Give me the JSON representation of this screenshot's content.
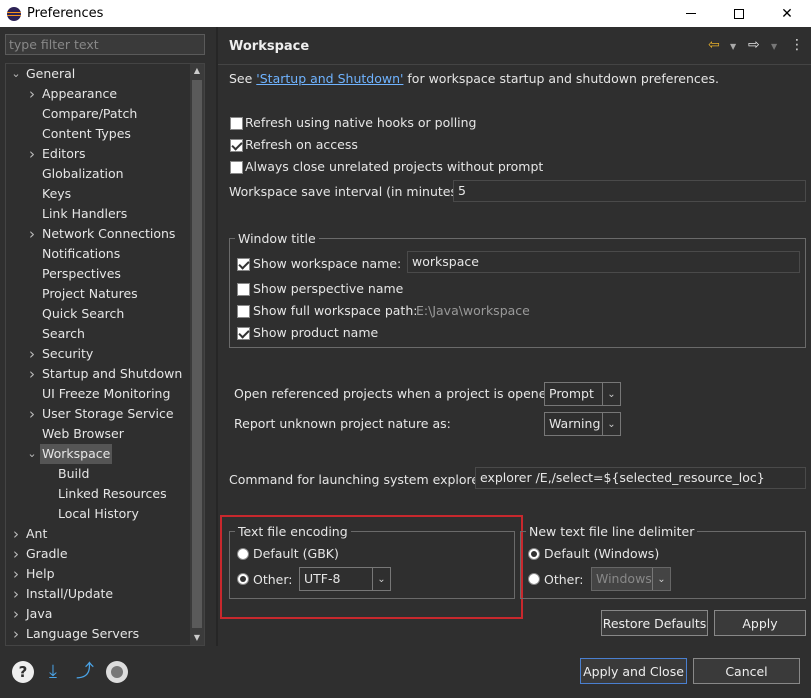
{
  "window": {
    "title": "Preferences"
  },
  "filter": {
    "placeholder": "type filter text"
  },
  "tree": [
    {
      "label": "General",
      "level": 0,
      "state": "expanded"
    },
    {
      "label": "Appearance",
      "level": 1,
      "state": "collapsed"
    },
    {
      "label": "Compare/Patch",
      "level": 1,
      "state": "leaf"
    },
    {
      "label": "Content Types",
      "level": 1,
      "state": "leaf"
    },
    {
      "label": "Editors",
      "level": 1,
      "state": "collapsed"
    },
    {
      "label": "Globalization",
      "level": 1,
      "state": "leaf"
    },
    {
      "label": "Keys",
      "level": 1,
      "state": "leaf"
    },
    {
      "label": "Link Handlers",
      "level": 1,
      "state": "leaf"
    },
    {
      "label": "Network Connections",
      "level": 1,
      "state": "collapsed"
    },
    {
      "label": "Notifications",
      "level": 1,
      "state": "leaf"
    },
    {
      "label": "Perspectives",
      "level": 1,
      "state": "leaf"
    },
    {
      "label": "Project Natures",
      "level": 1,
      "state": "leaf"
    },
    {
      "label": "Quick Search",
      "level": 1,
      "state": "leaf"
    },
    {
      "label": "Search",
      "level": 1,
      "state": "leaf"
    },
    {
      "label": "Security",
      "level": 1,
      "state": "collapsed"
    },
    {
      "label": "Startup and Shutdown",
      "level": 1,
      "state": "collapsed"
    },
    {
      "label": "UI Freeze Monitoring",
      "level": 1,
      "state": "leaf"
    },
    {
      "label": "User Storage Service",
      "level": 1,
      "state": "collapsed"
    },
    {
      "label": "Web Browser",
      "level": 1,
      "state": "leaf"
    },
    {
      "label": "Workspace",
      "level": 1,
      "state": "expanded",
      "selected": true
    },
    {
      "label": "Build",
      "level": 2,
      "state": "leaf"
    },
    {
      "label": "Linked Resources",
      "level": 2,
      "state": "leaf"
    },
    {
      "label": "Local History",
      "level": 2,
      "state": "leaf"
    },
    {
      "label": "Ant",
      "level": 0,
      "state": "collapsed"
    },
    {
      "label": "Gradle",
      "level": 0,
      "state": "collapsed"
    },
    {
      "label": "Help",
      "level": 0,
      "state": "collapsed"
    },
    {
      "label": "Install/Update",
      "level": 0,
      "state": "collapsed"
    },
    {
      "label": "Java",
      "level": 0,
      "state": "collapsed"
    },
    {
      "label": "Language Servers",
      "level": 0,
      "state": "collapsed"
    }
  ],
  "page": {
    "title": "Workspace",
    "see_prefix": "See ",
    "see_link": "'Startup and Shutdown'",
    "see_suffix": " for workspace startup and shutdown preferences.",
    "refresh_native": "Refresh using native hooks or polling",
    "refresh_access": "Refresh on access",
    "always_close": "Always close unrelated projects without prompt",
    "save_interval_label": "Workspace save interval (in minutes):",
    "save_interval_value": "5",
    "window_title_group": "Window title",
    "show_ws_name": "Show workspace name:",
    "ws_name_value": "workspace",
    "show_perspective": "Show perspective name",
    "show_full_path": "Show full workspace path:",
    "full_path_value": "E:\\Java\\workspace",
    "show_product": "Show product name",
    "open_ref_label": "Open referenced projects when a project is opened:",
    "open_ref_value": "Prompt",
    "report_nature_label": "Report unknown project nature as:",
    "report_nature_value": "Warning",
    "cmd_label": "Command for launching system explorer:",
    "cmd_value": "explorer /E,/select=${selected_resource_loc}",
    "encoding_group": "Text file encoding",
    "enc_default": "Default (GBK)",
    "enc_other": "Other:",
    "enc_other_value": "UTF-8",
    "delim_group": "New text file line delimiter",
    "delim_default": "Default (Windows)",
    "delim_other": "Other:",
    "delim_other_value": "Windows",
    "restore_defaults": "Restore Defaults",
    "apply": "Apply"
  },
  "footer": {
    "apply_close": "Apply and Close",
    "cancel": "Cancel"
  },
  "colors": {
    "highlight_box": "#c8282d",
    "link": "#6fb3ff"
  }
}
